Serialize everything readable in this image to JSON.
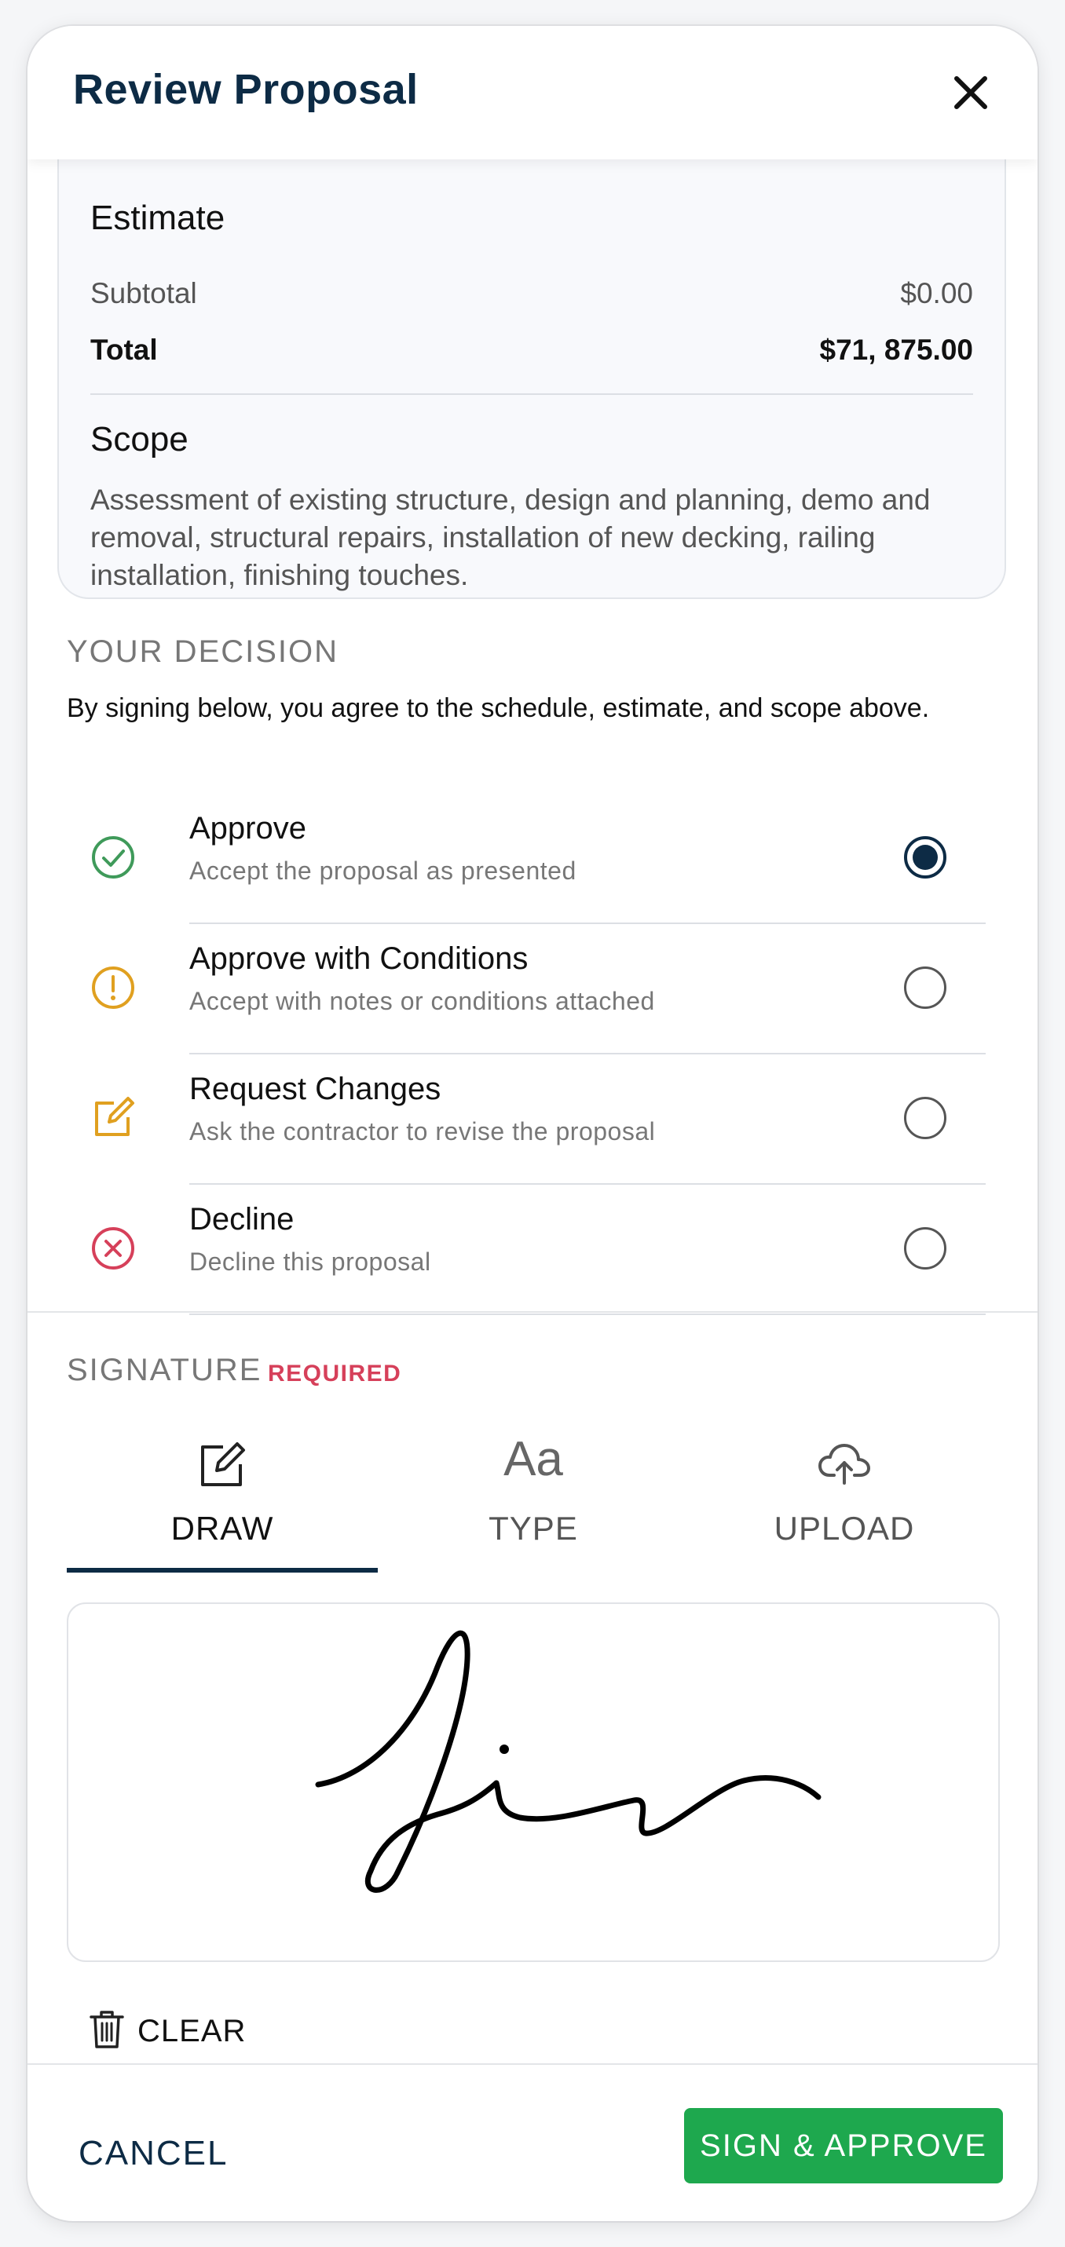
{
  "header": {
    "title": "Review Proposal"
  },
  "estimate": {
    "heading": "Estimate",
    "subtotal_label": "Subtotal",
    "subtotal_value": "$0.00",
    "total_label": "Total",
    "total_value": "$71, 875.00"
  },
  "scope": {
    "heading": "Scope",
    "text": "Assessment of existing structure, design and planning, demo and removal, structural repairs, installation of new decking, railing installation, finishing touches."
  },
  "decision": {
    "heading": "YOUR DECISION",
    "agreement": "By signing below, you agree to the schedule, estimate, and scope above.",
    "options": [
      {
        "title": "Approve",
        "subtitle": "Accept the proposal as presented",
        "icon": "check-circle-icon",
        "color": "#3f9a5a",
        "selected": true
      },
      {
        "title": "Approve with Conditions",
        "subtitle": "Accept with notes or conditions attached",
        "icon": "exclamation-circle-icon",
        "color": "#e0a020",
        "selected": false
      },
      {
        "title": "Request Changes",
        "subtitle": "Ask the contractor to revise the proposal",
        "icon": "edit-icon",
        "color": "#e0a020",
        "selected": false
      },
      {
        "title": "Decline",
        "subtitle": "Decline this proposal",
        "icon": "x-circle-icon",
        "color": "#d6405a",
        "selected": false
      }
    ]
  },
  "signature": {
    "heading": "SIGNATURE",
    "required": "REQUIRED",
    "tabs": [
      {
        "label": "DRAW",
        "icon": "pen-square-icon",
        "active": true
      },
      {
        "label": "TYPE",
        "icon": "Aa",
        "active": false
      },
      {
        "label": "UPLOAD",
        "icon": "cloud-upload-icon",
        "active": false
      }
    ],
    "clear_label": "CLEAR"
  },
  "footer": {
    "cancel_label": "CANCEL",
    "approve_label": "SIGN & APPROVE"
  },
  "colors": {
    "primary": "#0d2b45",
    "success": "#1ea84e",
    "required": "#d6405a"
  }
}
